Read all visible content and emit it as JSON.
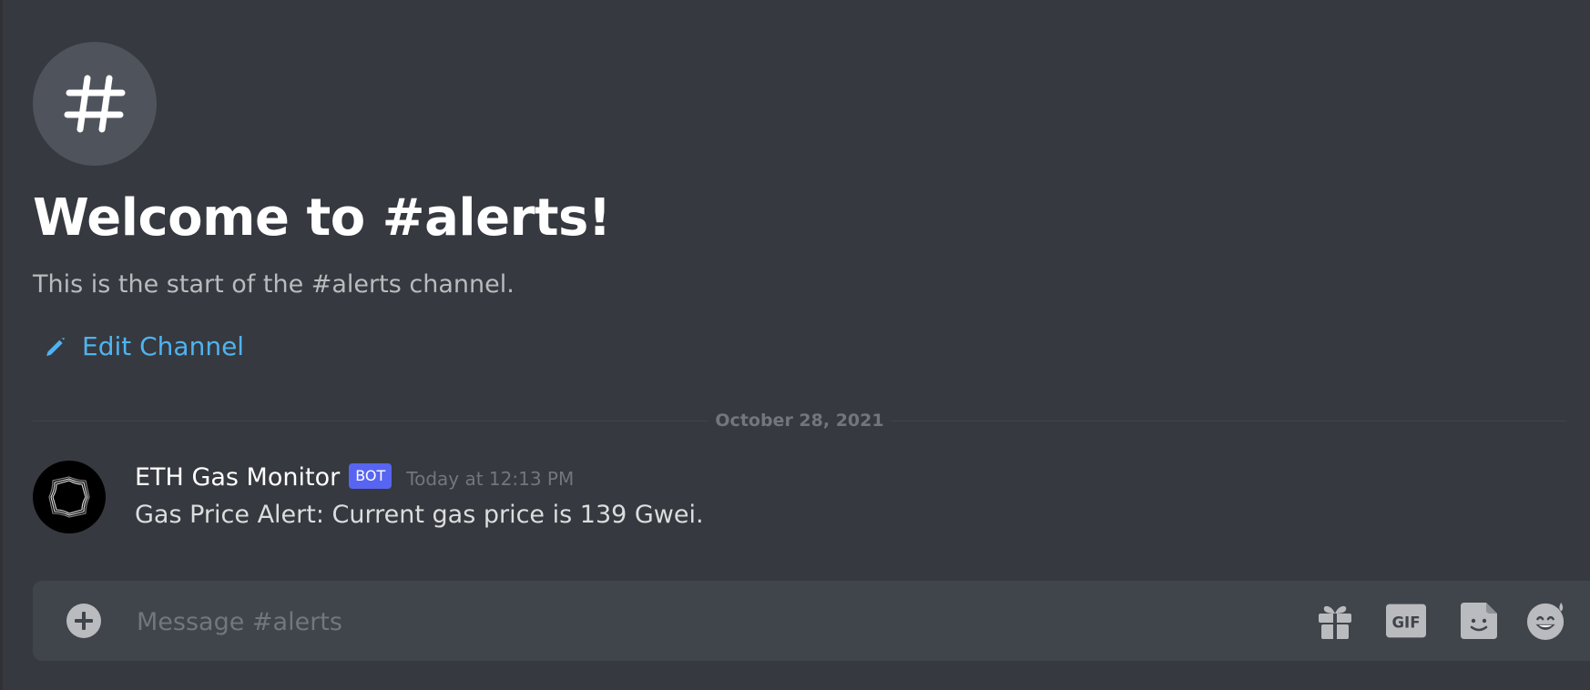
{
  "channel": {
    "name": "alerts",
    "welcome_title": "Welcome to #alerts!",
    "welcome_subtitle": "This is the start of the #alerts channel.",
    "edit_label": "Edit Channel"
  },
  "divider": {
    "date": "October 28, 2021"
  },
  "message": {
    "author": "ETH Gas Monitor",
    "tag": "BOT",
    "timestamp": "Today at 12:13 PM",
    "content": "Gas Price Alert: Current gas price is 139 Gwei."
  },
  "composer": {
    "placeholder": "Message #alerts",
    "value": ""
  },
  "icons": {
    "channel": "hashtag-icon",
    "edit": "pencil-icon",
    "add": "plus-circle-icon",
    "gift": "gift-icon",
    "gif": "gif-icon",
    "sticker": "sticker-icon",
    "emoji": "emoji-icon"
  },
  "colors": {
    "background": "#36393f",
    "composer": "#40444b",
    "link": "#00aff4",
    "bot_tag": "#5865f2"
  }
}
